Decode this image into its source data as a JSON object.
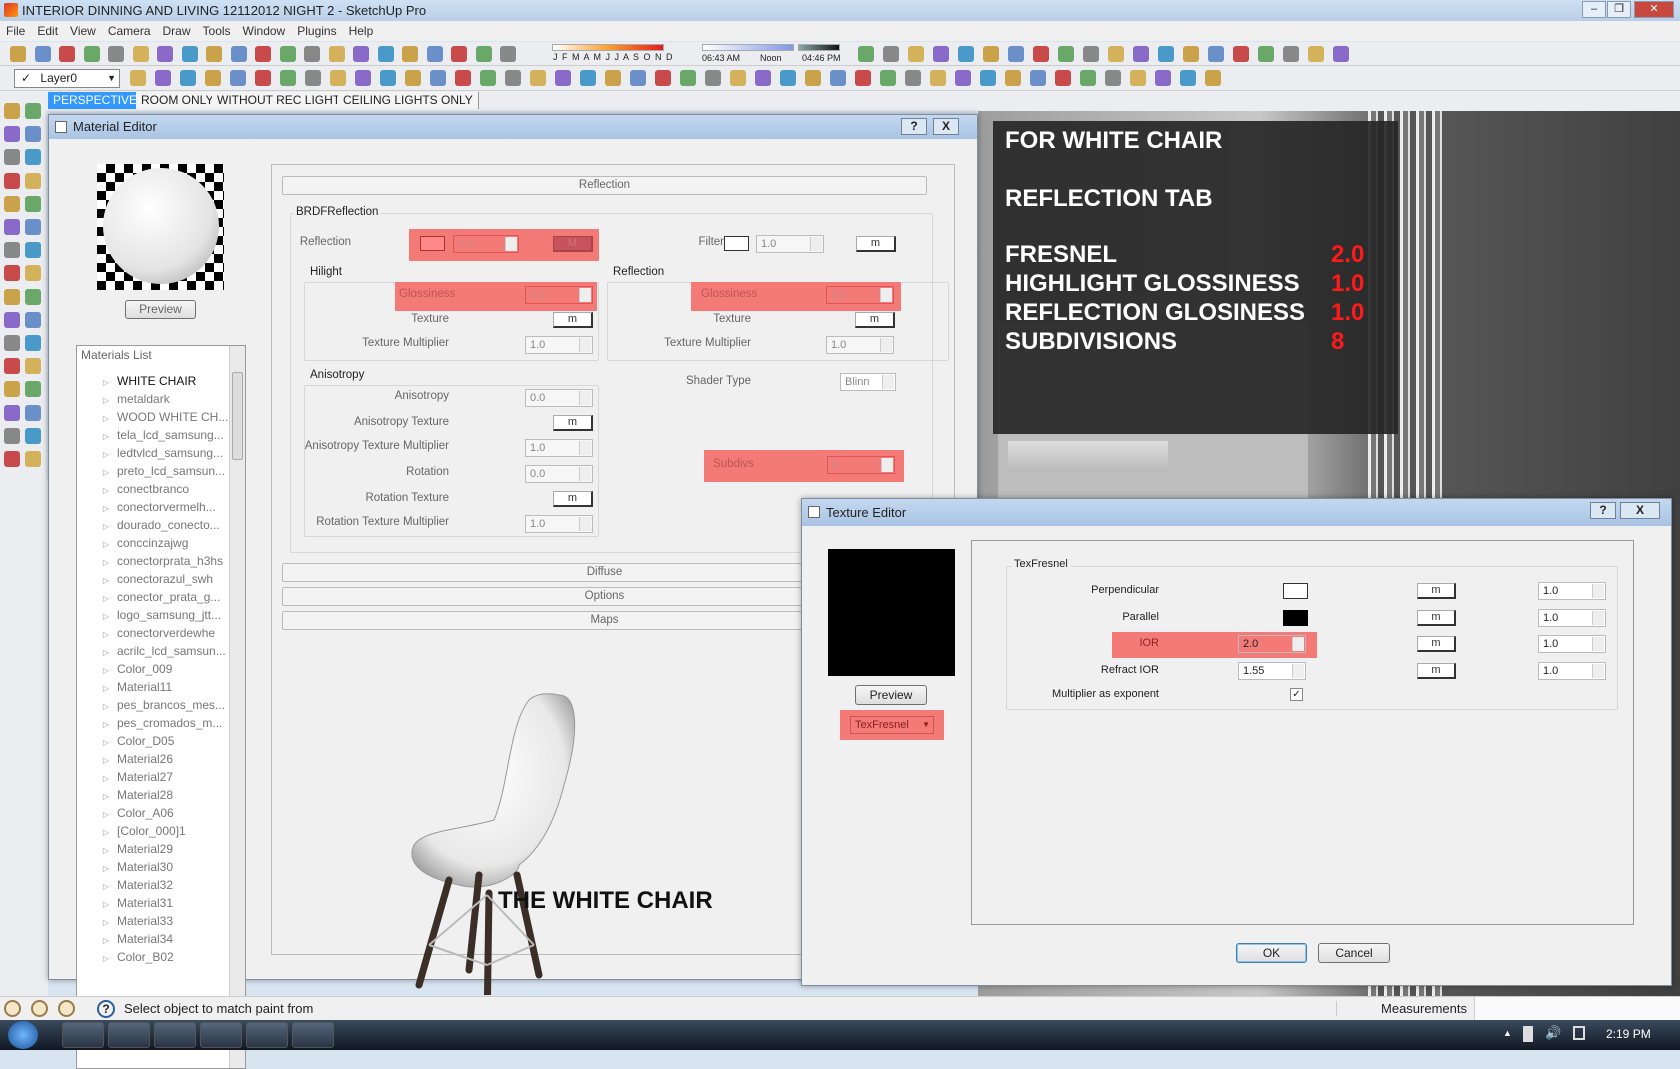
{
  "window": {
    "title": "INTERIOR DINNING AND LIVING 12112012 NIGHT 2 - SketchUp Pro"
  },
  "menu": [
    "File",
    "Edit",
    "View",
    "Camera",
    "Draw",
    "Tools",
    "Window",
    "Plugins",
    "Help"
  ],
  "toolbar": {
    "months": "J F M A M J J A S O N D",
    "time_start": "06:43 AM",
    "time_mid": "Noon",
    "time_end": "04:46 PM",
    "layer": "Layer0",
    "row1_icons": [
      "new-icon",
      "open-icon",
      "save-icon",
      "cut-icon",
      "copy-icon",
      "paste-icon",
      "erase-icon",
      "undo-icon",
      "redo-icon",
      "print-icon",
      "model-info-icon",
      "import-icon",
      "export-icon",
      "component-icon",
      "paint-icon",
      "google-earth-icon",
      "get-model-icon",
      "share-model-icon",
      "warehouse-icon",
      "shadow-icon",
      "fog-icon"
    ],
    "row1b_icons": [
      "vray-render-icon",
      "vray-options-icon",
      "vray-help-icon",
      "vray-fb-icon",
      "material-icon",
      "light-icon",
      "spot-light-icon",
      "ies-icon",
      "omni-icon",
      "dome-icon",
      "sphere-icon",
      "plane-icon",
      "proxy-icon",
      "plugin-icon",
      "plugin2-icon",
      "plugin3-icon",
      "plugin4-icon",
      "person-icon",
      "person2-icon",
      "person3-icon"
    ],
    "row2_icons": [
      "iso-view-icon",
      "top-view-icon",
      "front-view-icon",
      "right-view-icon",
      "back-view-icon",
      "left-view-icon",
      "xray-icon",
      "back-edges-icon",
      "wireframe-icon",
      "hidden-line-icon",
      "shaded-icon",
      "textured-icon",
      "monochrome-icon",
      "style1-icon",
      "style2-icon",
      "style3-icon",
      "style4-icon",
      "style5-icon",
      "style6-icon",
      "style7-icon",
      "style8-icon",
      "section-icon",
      "section2-icon",
      "axes-icon",
      "guides-icon",
      "sandbox-icon",
      "fog-toggle-icon",
      "solid-icon",
      "solid2-icon",
      "zoom-icon",
      "zoom2-icon",
      "grid-icon",
      "sphere-tool-icon",
      "tool1-icon",
      "tool2-icon",
      "tool3-icon",
      "tool4-icon",
      "tool5-icon",
      "tool6-icon",
      "tool7-icon",
      "tool8-icon",
      "tool9-icon",
      "tool10-icon",
      "close-tool-icon"
    ]
  },
  "scene_tabs": [
    "PERSPECTIVE",
    "ROOM ONLY",
    "WITHOUT REC LIGHTS",
    "CEILING LIGHTS ONLY"
  ],
  "left_tools": [
    "select-icon",
    "component-icon",
    "paint-bucket-icon",
    "eraser-icon",
    "rectangle-icon",
    "line-icon",
    "circle-icon",
    "arc-icon",
    "polygon-icon",
    "freehand-icon",
    "move-icon",
    "push-pull-icon",
    "rotate-icon",
    "follow-me-icon",
    "scale-icon",
    "offset-icon",
    "tape-icon",
    "dimension-icon",
    "protractor-icon",
    "text-icon",
    "axes-icon",
    "3d-text-icon",
    "orbit-icon",
    "pan-icon",
    "zoom-icon",
    "zoom-window-icon",
    "zoom-extents-icon",
    "previous-icon",
    "position-camera-icon",
    "look-around-icon",
    "walk-icon",
    "section-plane-icon"
  ],
  "material_editor": {
    "title": "Material Editor",
    "help": "?",
    "close": "X",
    "preview": "Preview",
    "list_title": "Materials List",
    "materials": [
      "WHITE CHAIR",
      "metaldark",
      "WOOD WHITE CH...",
      "tela_lcd_samsung...",
      "ledtvlcd_samsung...",
      "preto_lcd_samsun...",
      "conectbranco",
      "conectorvermelh...",
      "dourado_conecto...",
      "conccinzajwg",
      "conectorprata_h3hs",
      "conectorazul_swh",
      "conector_prata_g...",
      "logo_samsung_jtt...",
      "conectorverdewhe",
      "acrilc_lcd_samsun...",
      "Color_009",
      "Material11",
      "pes_brancos_mes...",
      "pes_cromados_m...",
      "Color_D05",
      "Material26",
      "Material27",
      "Material28",
      "Color_A06",
      "[Color_000]1",
      "Material29",
      "Material30",
      "Material32",
      "Material31",
      "Material33",
      "Material34",
      "Color_B02"
    ],
    "section": "Reflection",
    "brdf": {
      "title": "BRDFReflection",
      "reflection_label": "Reflection",
      "reflection_value": "1.0",
      "reflection_m": "M",
      "filter_label": "Filter",
      "filter_value": "1.0",
      "filter_m": "m",
      "hilight": {
        "title": "Hilight",
        "glossiness_label": "Glossiness",
        "glossiness": "1.0",
        "texture_label": "Texture",
        "texture_m": "m",
        "mult_label": "Texture Multiplier",
        "mult": "1.0"
      },
      "reflection": {
        "title": "Reflection",
        "glossiness_label": "Glossiness",
        "glossiness": "1.0",
        "texture_label": "Texture",
        "texture_m": "m",
        "mult_label": "Texture Multiplier",
        "mult": "1.0"
      },
      "anisotropy": {
        "title": "Anisotropy",
        "aniso_label": "Anisotropy",
        "aniso": "0.0",
        "aniso_tex_label": "Anisotropy Texture",
        "aniso_tex_m": "m",
        "aniso_mult_label": "Anisotropy Texture Multiplier",
        "aniso_mult": "1.0",
        "rotation_label": "Rotation",
        "rotation": "0.0",
        "rot_tex_label": "Rotation Texture",
        "rot_tex_m": "m",
        "rot_mult_label": "Rotation Texture Multiplier",
        "rot_mult": "1.0"
      },
      "shader_label": "Shader Type",
      "shader": "Blinn",
      "subdivs_label": "Subdivs",
      "subdivs": "8"
    },
    "sections": [
      "Diffuse",
      "Options",
      "Maps"
    ],
    "caption": "THE WHITE CHAIR"
  },
  "overlay": {
    "title1": "FOR WHITE CHAIR",
    "title2": "REFLECTION TAB",
    "rows": [
      {
        "label": "FRESNEL",
        "value": "2.0"
      },
      {
        "label": "HIGHLIGHT GLOSSINESS",
        "value": "1.0"
      },
      {
        "label": "REFLECTION GLOSINESS",
        "value": "1.0"
      },
      {
        "label": "SUBDIVISIONS",
        "value": "8"
      }
    ]
  },
  "texture_editor": {
    "title": "Texture Editor",
    "help": "?",
    "close": "X",
    "preview": "Preview",
    "type": "TexFresnel",
    "group": "TexFresnel",
    "rows": [
      {
        "label": "Perpendicular",
        "m": "m",
        "value": "1.0"
      },
      {
        "label": "Parallel",
        "m": "m",
        "value": "1.0"
      },
      {
        "label": "IOR",
        "input": "2.0",
        "m": "m",
        "value": "1.0"
      },
      {
        "label": "Refract IOR",
        "input": "1.55",
        "m": "m",
        "value": "1.0"
      }
    ],
    "multiplier_label": "Multiplier as exponent",
    "multiplier_checked": true,
    "ok": "OK",
    "cancel": "Cancel"
  },
  "status": {
    "text": "Select object to match paint from",
    "measurements": "Measurements"
  },
  "taskbar": {
    "apps": [
      "explorer-icon",
      "chrome-icon",
      "photoshop-icon",
      "window-icon",
      "paint-icon",
      "sketchup-icon"
    ],
    "clock": "2:19 PM"
  },
  "colors": {
    "highlight": "#f47a78",
    "overlay_value": "#ff1a1a",
    "tab_active": "#3399ff"
  }
}
